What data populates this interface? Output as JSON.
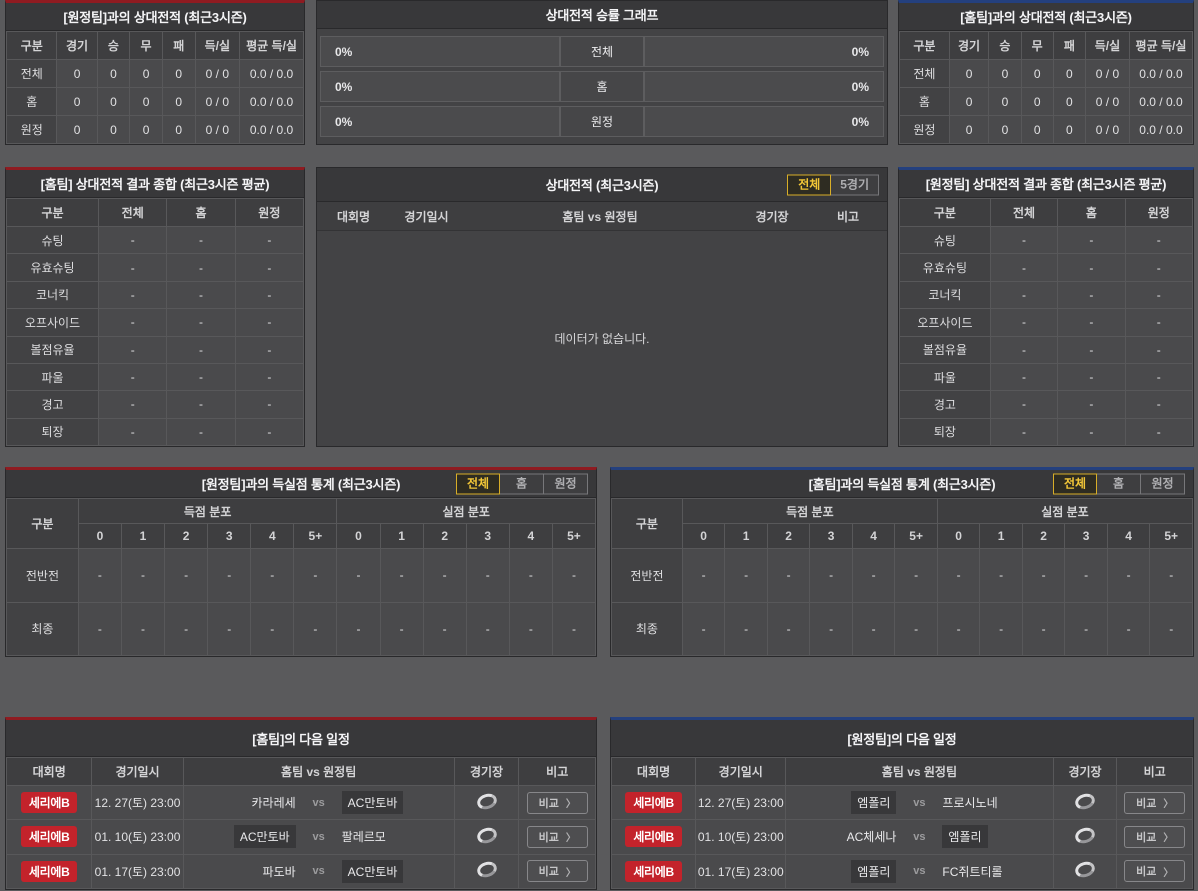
{
  "theme": {
    "accent_red": "#8f1b21",
    "accent_blue": "#24407e",
    "tab_active_yellow": "#f2c637",
    "badge_red": "#c3232b"
  },
  "h2h_vs_away": {
    "title": "[원정팀]과의 상대전적 (최근3시즌)",
    "columns": [
      "구분",
      "경기",
      "승",
      "무",
      "패",
      "득/실",
      "평균 득/실"
    ],
    "rows": [
      {
        "label": "전체",
        "values": [
          "0",
          "0",
          "0",
          "0",
          "0 / 0",
          "0.0 / 0.0"
        ]
      },
      {
        "label": "홈",
        "values": [
          "0",
          "0",
          "0",
          "0",
          "0 / 0",
          "0.0 / 0.0"
        ]
      },
      {
        "label": "원정",
        "values": [
          "0",
          "0",
          "0",
          "0",
          "0 / 0",
          "0.0 / 0.0"
        ]
      }
    ]
  },
  "winrate_graph": {
    "title": "상대전적 승률 그래프",
    "rows": [
      {
        "label": "전체",
        "left_pct": "0%",
        "right_pct": "0%"
      },
      {
        "label": "홈",
        "left_pct": "0%",
        "right_pct": "0%"
      },
      {
        "label": "원정",
        "left_pct": "0%",
        "right_pct": "0%"
      }
    ]
  },
  "h2h_vs_home": {
    "title": "[홈팀]과의 상대전적 (최근3시즌)",
    "columns": [
      "구분",
      "경기",
      "승",
      "무",
      "패",
      "득/실",
      "평균 득/실"
    ],
    "rows": [
      {
        "label": "전체",
        "values": [
          "0",
          "0",
          "0",
          "0",
          "0 / 0",
          "0.0 / 0.0"
        ]
      },
      {
        "label": "홈",
        "values": [
          "0",
          "0",
          "0",
          "0",
          "0 / 0",
          "0.0 / 0.0"
        ]
      },
      {
        "label": "원정",
        "values": [
          "0",
          "0",
          "0",
          "0",
          "0 / 0",
          "0.0 / 0.0"
        ]
      }
    ]
  },
  "summary_home": {
    "title": "[홈팀] 상대전적 결과 종합 (최근3시즌 평균)",
    "columns": [
      "구분",
      "전체",
      "홈",
      "원정"
    ],
    "rows": [
      {
        "label": "슈팅",
        "values": [
          "-",
          "-",
          "-"
        ]
      },
      {
        "label": "유효슈팅",
        "values": [
          "-",
          "-",
          "-"
        ]
      },
      {
        "label": "코너킥",
        "values": [
          "-",
          "-",
          "-"
        ]
      },
      {
        "label": "오프사이드",
        "values": [
          "-",
          "-",
          "-"
        ]
      },
      {
        "label": "볼점유율",
        "values": [
          "-",
          "-",
          "-"
        ]
      },
      {
        "label": "파울",
        "values": [
          "-",
          "-",
          "-"
        ]
      },
      {
        "label": "경고",
        "values": [
          "-",
          "-",
          "-"
        ]
      },
      {
        "label": "퇴장",
        "values": [
          "-",
          "-",
          "-"
        ]
      }
    ]
  },
  "h2h_list": {
    "title": "상대전적 (최근3시즌)",
    "tabs": [
      {
        "label": "전체",
        "active": true
      },
      {
        "label": "5경기",
        "active": false
      }
    ],
    "columns": [
      "대회명",
      "경기일시",
      "홈팀 vs 원정팀",
      "경기장",
      "비고"
    ],
    "empty_message": "데이터가 없습니다."
  },
  "summary_away": {
    "title": "[원정팀] 상대전적 결과 종합 (최근3시즌 평균)",
    "columns": [
      "구분",
      "전체",
      "홈",
      "원정"
    ],
    "rows": [
      {
        "label": "슈팅",
        "values": [
          "-",
          "-",
          "-"
        ]
      },
      {
        "label": "유효슈팅",
        "values": [
          "-",
          "-",
          "-"
        ]
      },
      {
        "label": "코너킥",
        "values": [
          "-",
          "-",
          "-"
        ]
      },
      {
        "label": "오프사이드",
        "values": [
          "-",
          "-",
          "-"
        ]
      },
      {
        "label": "볼점유율",
        "values": [
          "-",
          "-",
          "-"
        ]
      },
      {
        "label": "파울",
        "values": [
          "-",
          "-",
          "-"
        ]
      },
      {
        "label": "경고",
        "values": [
          "-",
          "-",
          "-"
        ]
      },
      {
        "label": "퇴장",
        "values": [
          "-",
          "-",
          "-"
        ]
      }
    ]
  },
  "score_stats_left": {
    "title": "[원정팀]과의 득실점 통계 (최근3시즌)",
    "tabs": [
      {
        "label": "전체",
        "active": true
      },
      {
        "label": "홈",
        "active": false
      },
      {
        "label": "원정",
        "active": false
      }
    ],
    "corner_label": "구분",
    "group_headers": [
      "득점 분포",
      "실점 분포"
    ],
    "sub_columns": [
      "0",
      "1",
      "2",
      "3",
      "4",
      "5+"
    ],
    "rows": [
      {
        "label": "전반전",
        "values": [
          "-",
          "-",
          "-",
          "-",
          "-",
          "-",
          "-",
          "-",
          "-",
          "-",
          "-",
          "-"
        ]
      },
      {
        "label": "최종",
        "values": [
          "-",
          "-",
          "-",
          "-",
          "-",
          "-",
          "-",
          "-",
          "-",
          "-",
          "-",
          "-"
        ]
      }
    ]
  },
  "score_stats_right": {
    "title": "[홈팀]과의 득실점 통계 (최근3시즌)",
    "tabs": [
      {
        "label": "전체",
        "active": true
      },
      {
        "label": "홈",
        "active": false
      },
      {
        "label": "원정",
        "active": false
      }
    ],
    "corner_label": "구분",
    "group_headers": [
      "득점 분포",
      "실점 분포"
    ],
    "sub_columns": [
      "0",
      "1",
      "2",
      "3",
      "4",
      "5+"
    ],
    "rows": [
      {
        "label": "전반전",
        "values": [
          "-",
          "-",
          "-",
          "-",
          "-",
          "-",
          "-",
          "-",
          "-",
          "-",
          "-",
          "-"
        ]
      },
      {
        "label": "최종",
        "values": [
          "-",
          "-",
          "-",
          "-",
          "-",
          "-",
          "-",
          "-",
          "-",
          "-",
          "-",
          "-"
        ]
      }
    ]
  },
  "schedule_home": {
    "title": "[홈팀]의 다음 일정",
    "columns": [
      "대회명",
      "경기일시",
      "홈팀 vs 원정팀",
      "경기장",
      "비고"
    ],
    "vs_label": "vs",
    "compare_label": "비교",
    "compare_chevron": "〉",
    "rows": [
      {
        "league": "세리에B",
        "datetime": "12. 27(토) 23:00",
        "home": "카라레세",
        "away": "AC만토바",
        "home_highlighted": false,
        "away_highlighted": true
      },
      {
        "league": "세리에B",
        "datetime": "01. 10(토) 23:00",
        "home": "AC만토바",
        "away": "팔레르모",
        "home_highlighted": true,
        "away_highlighted": false
      },
      {
        "league": "세리에B",
        "datetime": "01. 17(토) 23:00",
        "home": "파도바",
        "away": "AC만토바",
        "home_highlighted": false,
        "away_highlighted": true
      }
    ]
  },
  "schedule_away": {
    "title": "[원정팀]의 다음 일정",
    "columns": [
      "대회명",
      "경기일시",
      "홈팀 vs 원정팀",
      "경기장",
      "비고"
    ],
    "vs_label": "vs",
    "compare_label": "비교",
    "compare_chevron": "〉",
    "rows": [
      {
        "league": "세리에B",
        "datetime": "12. 27(토) 23:00",
        "home": "엠폴리",
        "away": "프로시노네",
        "home_highlighted": true,
        "away_highlighted": false
      },
      {
        "league": "세리에B",
        "datetime": "01. 10(토) 23:00",
        "home": "AC체세나",
        "away": "엠폴리",
        "home_highlighted": false,
        "away_highlighted": true
      },
      {
        "league": "세리에B",
        "datetime": "01. 17(토) 23:00",
        "home": "엠폴리",
        "away": "FC쥐트티롤",
        "home_highlighted": true,
        "away_highlighted": false
      }
    ]
  }
}
